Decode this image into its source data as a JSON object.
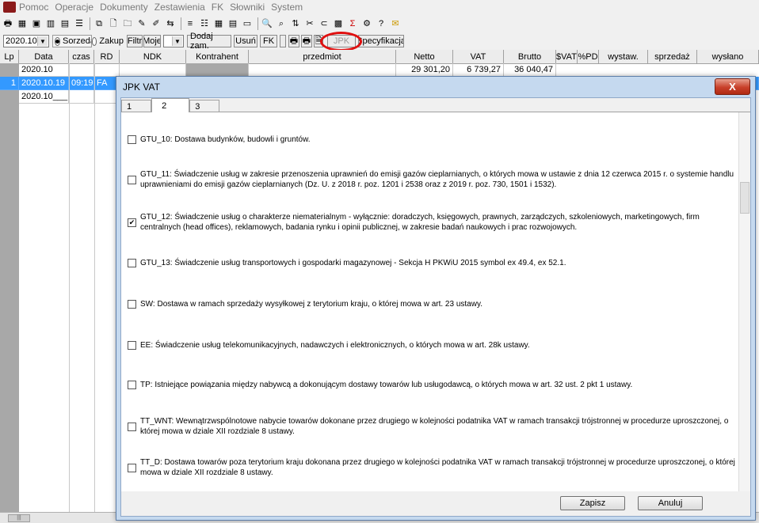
{
  "menu": [
    "Pomoc",
    "Operacje",
    "Dokumenty",
    "Zestawienia",
    "FK",
    "Słowniki",
    "System"
  ],
  "filter": {
    "period_value": "2020.10",
    "radio1_label": "Sorzeda",
    "radio2_label": "Zakup",
    "filtr_label": "Filtr",
    "moje_label": "Moje",
    "add_label": "Dodaj zam.",
    "delete_label": "Usuń",
    "fk_label": "FK",
    "jpk_label": "JPK",
    "spec_label": "Specyfikacja"
  },
  "grid": {
    "columns": [
      "Lp",
      "Data",
      "czas",
      "RD",
      "NDK",
      "Kontrahent",
      "przedmiot",
      "Netto",
      "VAT",
      "Brutto",
      "$VAT",
      "%PD",
      "wystaw.",
      "sprzedaż",
      "wysłano"
    ],
    "rows": [
      {
        "lp": "",
        "data": "2020.10",
        "czas": "",
        "rd": "",
        "netto": "29 301,20",
        "vat": "6 739,27",
        "brutto": "36 040,47"
      },
      {
        "lp": "1",
        "data": "2020.10.19",
        "czas": "09:19",
        "rd": "FA",
        "netto": "",
        "vat": "",
        "brutto": ""
      },
      {
        "lp": "",
        "data": "2020.10___",
        "czas": "",
        "rd": "",
        "netto": "",
        "vat": "",
        "brutto": ""
      }
    ]
  },
  "dialog": {
    "title": "JPK VAT",
    "close_label": "X",
    "tabs": [
      "1",
      "2",
      "3"
    ],
    "active_tab": "2",
    "items": [
      {
        "text": "GTU_10: Dostawa budynków, budowli i gruntów.",
        "checked": false
      },
      {
        "text": "GTU_11: Świadczenie usług w zakresie przenoszenia uprawnień do emisji gazów cieplarnianych, o których mowa w ustawie z dnia 12 czerwca 2015 r. o systemie handlu uprawnieniami do emisji gazów cieplarnianych (Dz. U. z 2018 r. poz. 1201 i 2538 oraz z 2019 r. poz. 730, 1501 i 1532).",
        "checked": false
      },
      {
        "text": "GTU_12: Świadczenie usług o charakterze niematerialnym - wyłącznie: doradczych, księgowych, prawnych, zarządczych, szkoleniowych, marketingowych, firm centralnych (head offices), reklamowych, badania rynku i opinii publicznej, w zakresie badań naukowych i prac rozwojowych.",
        "checked": true
      },
      {
        "text": "GTU_13: Świadczenie usług transportowych i gospodarki magazynowej - Sekcja H PKWiU 2015 symbol ex 49.4, ex 52.1.",
        "checked": false
      },
      {
        "text": "SW: Dostawa w ramach sprzedaży wysyłkowej z terytorium kraju, o której mowa w art. 23 ustawy.",
        "checked": false
      },
      {
        "text": "EE: Świadczenie usług telekomunikacyjnych, nadawczych i elektronicznych, o których mowa w art. 28k ustawy.",
        "checked": false
      },
      {
        "text": "TP: Istniejące powiązania między nabywcą a dokonującym dostawy towarów lub usługodawcą, o których mowa w art. 32 ust. 2 pkt 1 ustawy.",
        "checked": false
      },
      {
        "text": "TT_WNT: Wewnątrzwspólnotowe nabycie towarów dokonane przez drugiego w kolejności podatnika VAT w ramach transakcji trójstronnej w procedurze uproszczonej, o której mowa w dziale XII rozdziale 8 ustawy.",
        "checked": false
      },
      {
        "text": "TT_D: Dostawa towarów poza terytorium kraju dokonana przez drugiego w kolejności podatnika VAT w ramach transakcji trójstronnej w procedurze uproszczonej, o której mowa w dziale XII rozdziale 8 ustawy.",
        "checked": false
      }
    ],
    "save_label": "Zapisz",
    "cancel_label": "Anuluj"
  },
  "colors": {
    "selection": "#3399ff",
    "highlight_oval": "#e01010",
    "dialog_frame": "#c5d9ef"
  }
}
